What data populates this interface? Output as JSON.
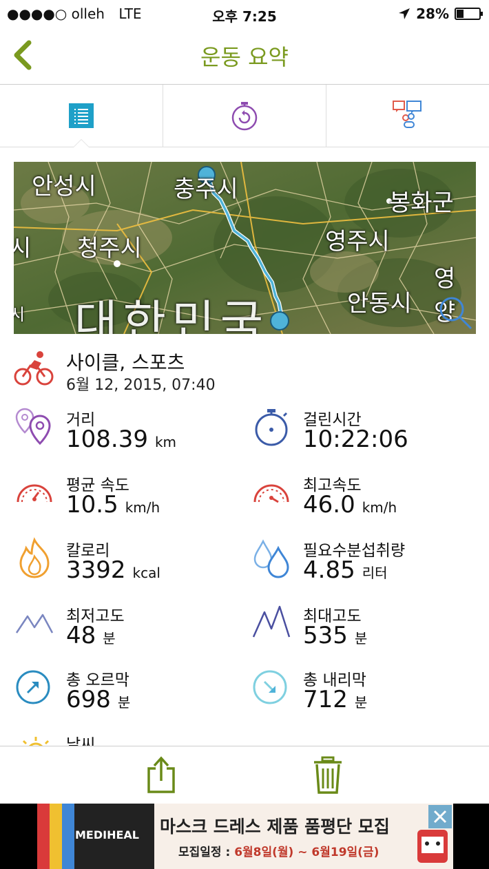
{
  "status_bar": {
    "carrier": "●●●●○ olleh",
    "network": "LTE",
    "time": "오후 7:25",
    "battery": "28%"
  },
  "nav": {
    "title": "운동 요약"
  },
  "tabs": [
    {
      "icon": "list-icon",
      "active": true
    },
    {
      "icon": "stopwatch-icon",
      "active": false
    },
    {
      "icon": "compare-icon",
      "active": false
    }
  ],
  "map": {
    "labels": [
      "안성시",
      "충주시",
      "봉화군",
      "청주시",
      "영주시",
      "영양",
      "안동시",
      "대한민국",
      "시",
      "시"
    ]
  },
  "activity": {
    "name": "사이클, 스포츠",
    "date": "6월 12, 2015, 07:40"
  },
  "stats": {
    "distance": {
      "label": "거리",
      "value": "108.39",
      "unit": "km"
    },
    "duration": {
      "label": "걸린시간",
      "value": "10:22:06",
      "unit": ""
    },
    "avg_speed": {
      "label": "평균 속도",
      "value": "10.5",
      "unit": "km/h"
    },
    "max_speed": {
      "label": "최고속도",
      "value": "46.0",
      "unit": "km/h"
    },
    "calories": {
      "label": "칼로리",
      "value": "3392",
      "unit": "kcal"
    },
    "hydration": {
      "label": "필요수분섭취량",
      "value": "4.85",
      "unit": "리터"
    },
    "min_alt": {
      "label": "최저고도",
      "value": "48",
      "unit": "분"
    },
    "max_alt": {
      "label": "최대고도",
      "value": "535",
      "unit": "분"
    },
    "ascent": {
      "label": "총 오르막",
      "value": "698",
      "unit": "분"
    },
    "descent": {
      "label": "총 내리막",
      "value": "712",
      "unit": "분"
    },
    "weather": {
      "label": "날씨"
    }
  },
  "ad": {
    "brand": "MEDIHEAL",
    "title": "마스크 드레스 제품 품평단 모집",
    "sub_prefix": "모집일정 : ",
    "sub_dates": "6월8일(월) ~ 6월19일(금)"
  },
  "colors": {
    "accent": "#7a9a1f",
    "route": "#4fb3d9",
    "distance": "#8e4cb0",
    "speed": "#d9433c",
    "calories": "#f0a030",
    "water": "#3f86d6",
    "altitude": "#5a5fa8",
    "ascent": "#2a8cc0",
    "descent": "#7fd0e0"
  }
}
